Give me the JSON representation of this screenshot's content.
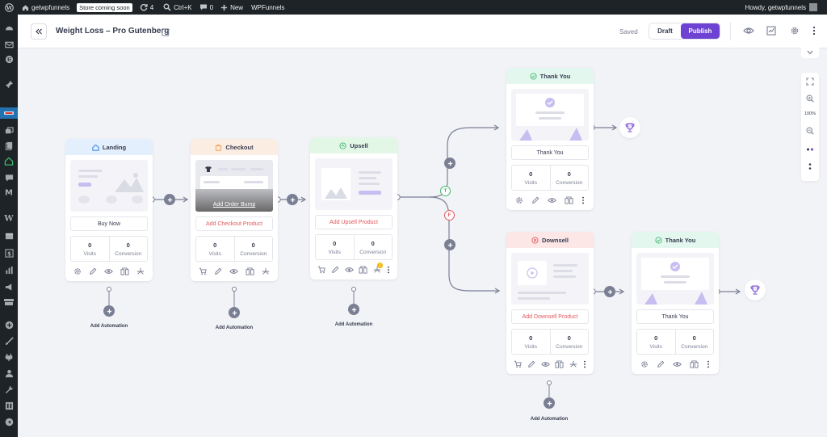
{
  "admin_bar": {
    "site_name": "getwpfunnels",
    "store_badge": "Store coming soon",
    "updates_count": "4",
    "search_shortcut": "Ctrl+K",
    "comments_count": "0",
    "new_label": "New",
    "plugin_label": "WPFunnels",
    "greeting": "Howdy, getwpfunnels"
  },
  "header": {
    "funnel_title": "Weight Loss – Pro Gutenberg",
    "saved_label": "Saved",
    "draft_label": "Draft",
    "publish_label": "Publish"
  },
  "nodes": {
    "landing": {
      "title": "Landing",
      "action": "Buy Now",
      "visits_value": "0",
      "visits_label": "Visits",
      "conversion_value": "0",
      "conversion_label": "Conversion",
      "automation_label": "Add Automation"
    },
    "checkout": {
      "title": "Checkout",
      "order_bump": "Add Order Bump",
      "action": "Add Checkout Product",
      "visits_value": "0",
      "visits_label": "Visits",
      "conversion_value": "0",
      "conversion_label": "Conversion",
      "automation_label": "Add Automation"
    },
    "upsell": {
      "title": "Upsell",
      "action": "Add Upsell Product",
      "visits_value": "0",
      "visits_label": "Visits",
      "conversion_value": "0",
      "conversion_label": "Conversion",
      "automation_label": "Add Automation",
      "notification_count": "1"
    },
    "thankyou_top": {
      "title": "Thank You",
      "action": "Thank You",
      "visits_value": "0",
      "visits_label": "Visits",
      "conversion_value": "0",
      "conversion_label": "Conversion"
    },
    "downsell": {
      "title": "Downsell",
      "action": "Add Downsell Product",
      "visits_value": "0",
      "visits_label": "Visits",
      "conversion_value": "0",
      "conversion_label": "Conversion",
      "automation_label": "Add Automation"
    },
    "thankyou_bottom": {
      "title": "Thank You",
      "action": "Thank You",
      "visits_value": "0",
      "visits_label": "Visits",
      "conversion_value": "0",
      "conversion_label": "Conversion"
    }
  },
  "branch_labels": {
    "true_label": "T",
    "false_label": "F"
  },
  "zoom": {
    "level": "100%"
  },
  "colors": {
    "publish": "#6e42d3",
    "landing_head": "#e3effc",
    "checkout_head": "#fcede3",
    "upsell_head": "#e3f7e7",
    "thankyou_head": "#e3f7ef",
    "downsell_head": "#fce6e6",
    "red_text": "#e2575b",
    "true_badge": "#3fb66b",
    "false_badge": "#e2575b"
  }
}
